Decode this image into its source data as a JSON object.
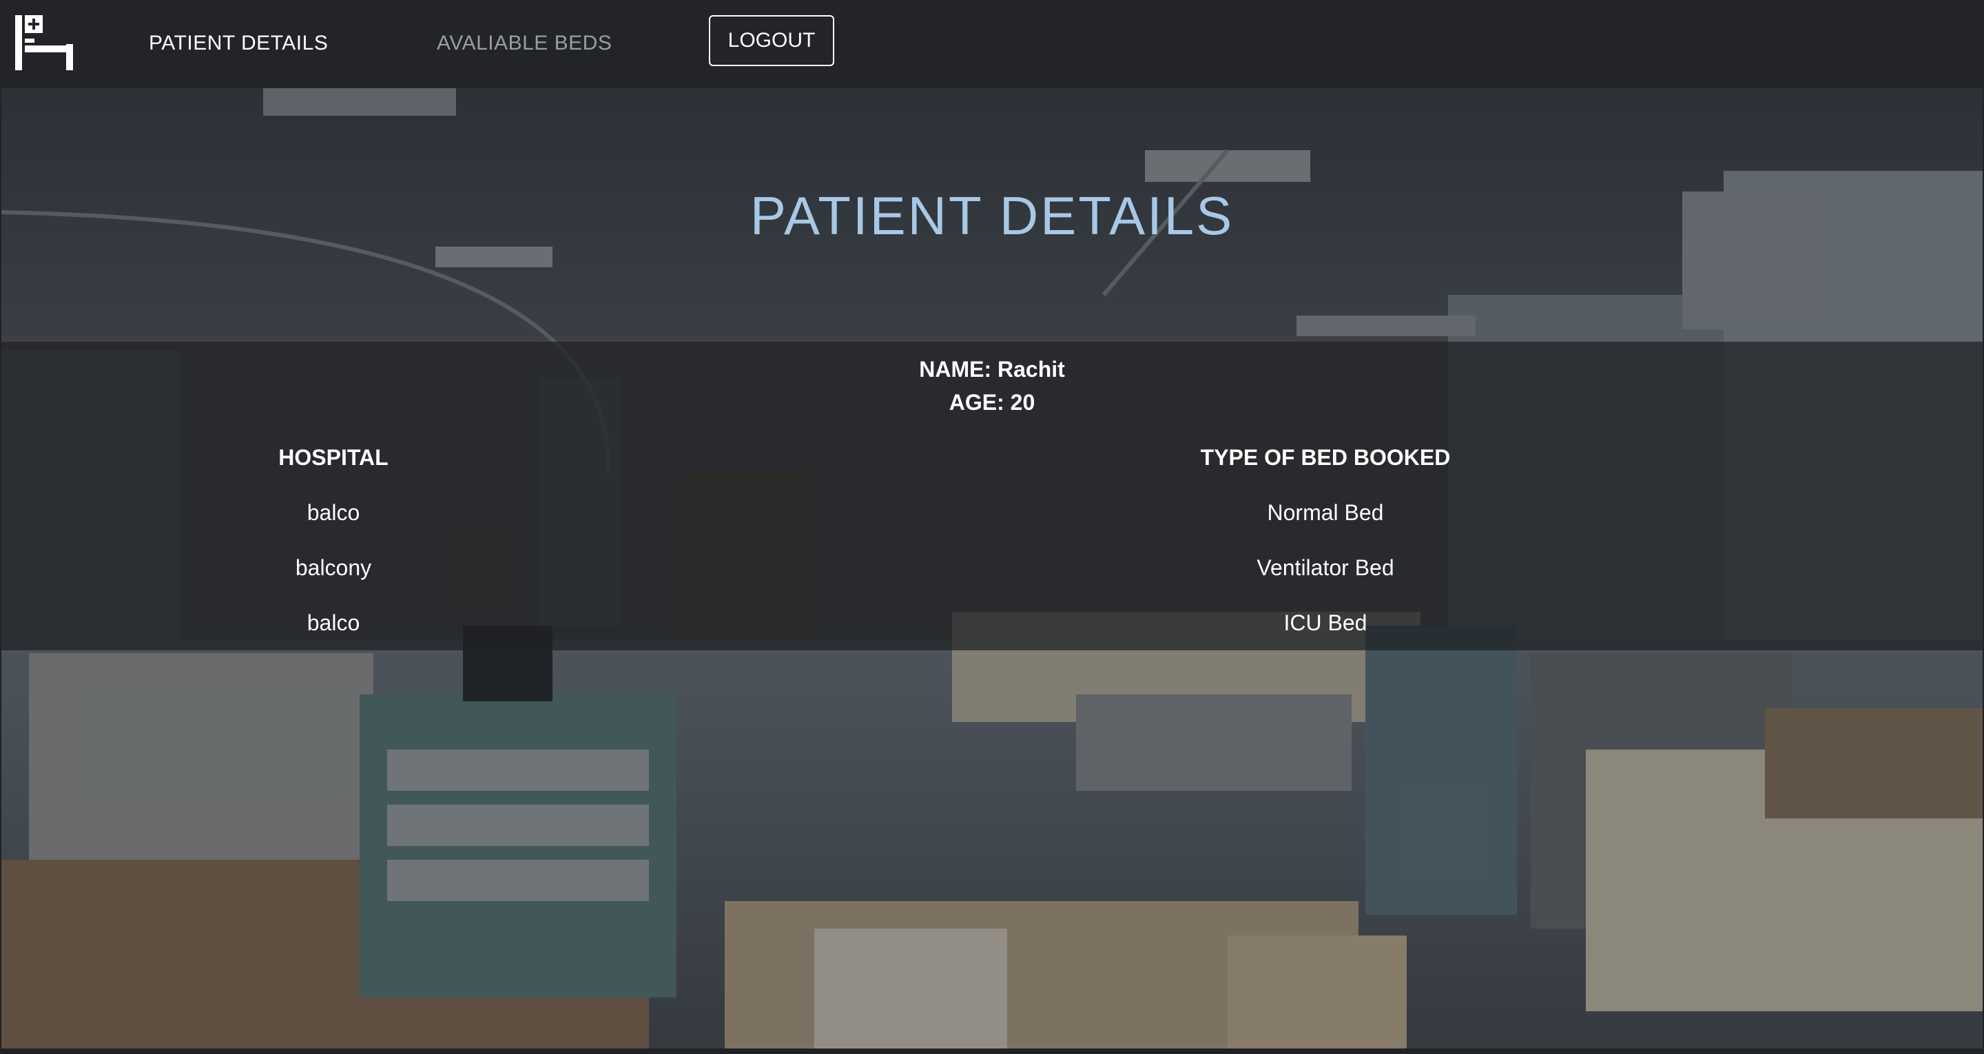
{
  "nav": {
    "logo_icon": "hospital-bed-icon",
    "links": [
      {
        "label": "PATIENT DETAILS",
        "active": true
      },
      {
        "label": "AVALIABLE BEDS",
        "active": false
      }
    ],
    "logout_label": "LOGOUT"
  },
  "page": {
    "title": "PATIENT DETAILS",
    "name_line": "NAME: Rachit",
    "age_line": "AGE: 20"
  },
  "table": {
    "headers": [
      "HOSPITAL",
      "TYPE OF BED BOOKED"
    ],
    "rows": [
      {
        "hospital": "balco",
        "bed_type": "Normal Bed"
      },
      {
        "hospital": "balcony",
        "bed_type": "Ventilator Bed"
      },
      {
        "hospital": "balco",
        "bed_type": "ICU Bed"
      }
    ]
  },
  "colors": {
    "navbar": "#222428",
    "title": "#a9c8e6",
    "text": "#ffffff",
    "muted_link": "#9a9da1"
  }
}
